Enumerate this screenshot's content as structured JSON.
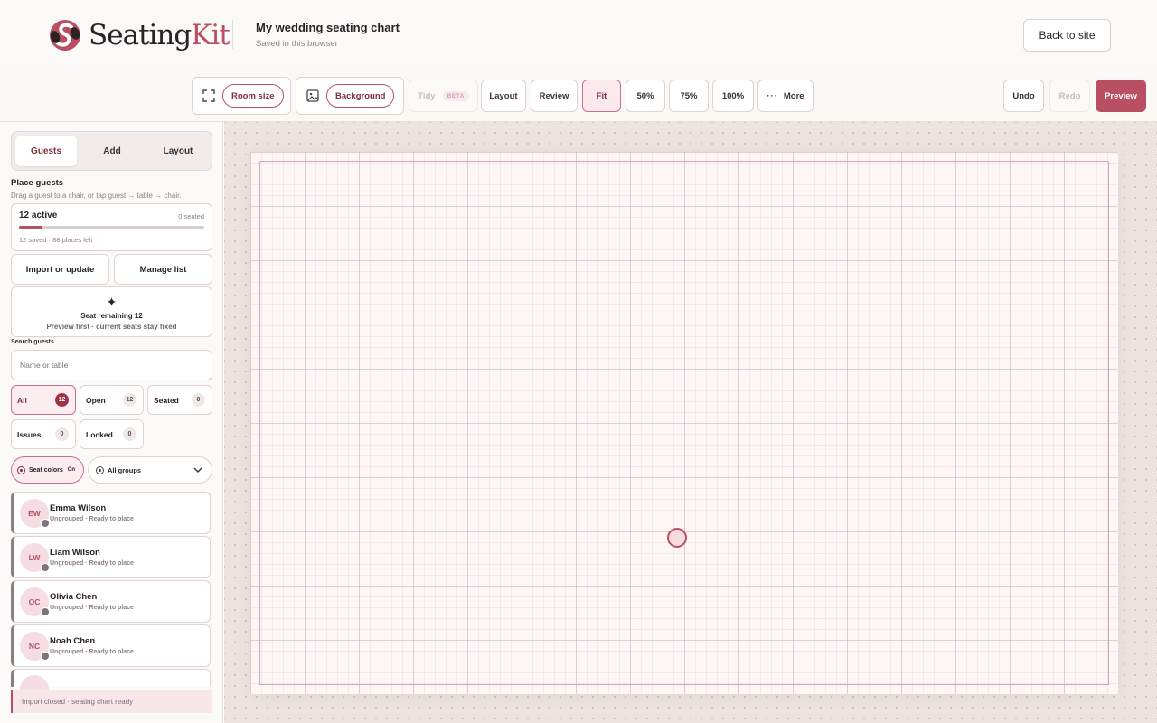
{
  "brand": {
    "name_a": "Seating",
    "name_b": "Kit"
  },
  "doc": {
    "title": "My wedding seating chart",
    "subtitle": "Saved in this browser"
  },
  "header": {
    "back_label": "Back to site"
  },
  "toolbar": {
    "room_size": "Room size",
    "background": "Background",
    "tidy": "Tidy",
    "beta": "BETA",
    "layout": "Layout",
    "review": "Review",
    "fit": "Fit",
    "zoom50": "50%",
    "zoom75": "75%",
    "zoom100": "100%",
    "more": "More",
    "undo": "Undo",
    "redo": "Redo",
    "preview": "Preview"
  },
  "sidebar": {
    "tabs": [
      "Guests",
      "Add",
      "Layout"
    ],
    "active_tab": "Guests",
    "place_title": "Place guests",
    "place_sub": "Drag a guest to a chair, or tap guest → table → chair.",
    "stats": {
      "active": "12 active",
      "seated": "0 seated",
      "saved": "12 saved · 88 places left",
      "progress_fraction": 0.12
    },
    "import_label": "Import or update",
    "manage_label": "Manage list",
    "seat_card": {
      "icon": "sparkle-icon",
      "title": "Seat remaining 12",
      "subtitle": "Preview first · current seats stay fixed"
    },
    "search": {
      "label": "Search guests",
      "placeholder": "Name or table",
      "value": ""
    },
    "filters": [
      {
        "label": "All",
        "count": "12",
        "active": true
      },
      {
        "label": "Open",
        "count": "12"
      },
      {
        "label": "Seated",
        "count": "0"
      },
      {
        "label": "Issues",
        "count": "0"
      },
      {
        "label": "Locked",
        "count": "0"
      }
    ],
    "seat_colors": {
      "label": "Seat colors",
      "state": "On"
    },
    "groups_select": {
      "selected": "All groups"
    },
    "guests": [
      {
        "initials": "EW",
        "name": "Emma Wilson",
        "status": "Ungrouped · Ready to place"
      },
      {
        "initials": "LW",
        "name": "Liam Wilson",
        "status": "Ungrouped · Ready to place"
      },
      {
        "initials": "OC",
        "name": "Olivia Chen",
        "status": "Ungrouped · Ready to place"
      },
      {
        "initials": "NC",
        "name": "Noah Chen",
        "status": "Ungrouped · Ready to place"
      }
    ],
    "toast": "Import closed · seating chart ready"
  },
  "colors": {
    "accent": "#b94f62",
    "accent_light": "#fbecef",
    "canvas_bg": "#ebe4e1",
    "room_bg": "#fcf7f5"
  }
}
